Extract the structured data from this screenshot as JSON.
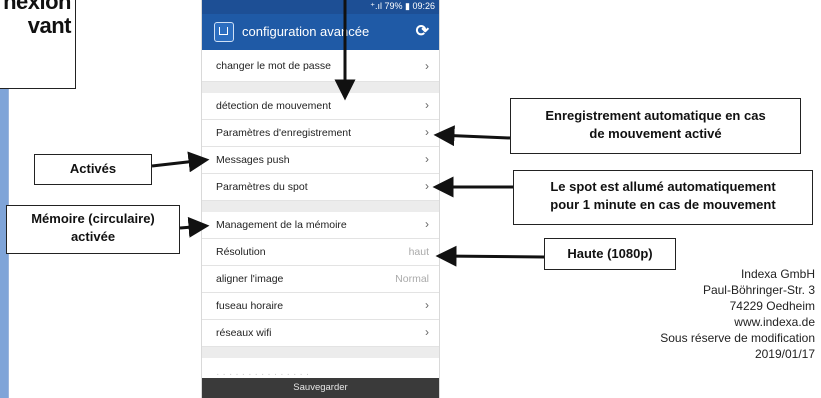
{
  "left_callout": {
    "line1": "nexion",
    "line2": "vant"
  },
  "phone": {
    "status": "⁺.ıl 79% ▮ 09:26",
    "app_title": "configuration avancée",
    "rows_group1": [
      {
        "label": "changer le mot de passe"
      }
    ],
    "rows_group2": [
      {
        "label": "détection de mouvement"
      },
      {
        "label": "Paramètres d'enregistrement"
      },
      {
        "label": "Messages push"
      },
      {
        "label": "Paramètres du spot"
      }
    ],
    "rows_group3": [
      {
        "label": "Management de la mémoire",
        "value": ""
      },
      {
        "label": "Résolution",
        "value": "haut"
      },
      {
        "label": "aligner l'image",
        "value": "Normal"
      },
      {
        "label": "fuseau horaire",
        "value": ""
      },
      {
        "label": "réseaux wifi",
        "value": ""
      }
    ],
    "partial_row": "· · · · · · · · · · · · · · ·",
    "save_label": "Sauvegarder",
    "chevron": "›"
  },
  "callouts": {
    "activated": "Activés",
    "memory_line1": "Mémoire (circulaire)",
    "memory_line2": "activée",
    "recording_line1": "Enregistrement automatique en cas",
    "recording_line2": "de mouvement activé",
    "spot_line1": "Le spot est allumé automatiquement",
    "spot_line2": "pour 1 minute en cas de mouvement",
    "resolution": "Haute (1080p)"
  },
  "company": {
    "name": "Indexa GmbH",
    "street": "Paul-Böhringer-Str. 3",
    "city": "74229 Oedheim",
    "web": "www.indexa.de",
    "note": "Sous réserve de modification",
    "date": "2019/01/17"
  },
  "colors": {
    "app_bar": "#1f5aa6",
    "status_bar": "#1d4f95",
    "save_bar": "#3a3a3a",
    "left_bar": "#7fa4d8"
  }
}
